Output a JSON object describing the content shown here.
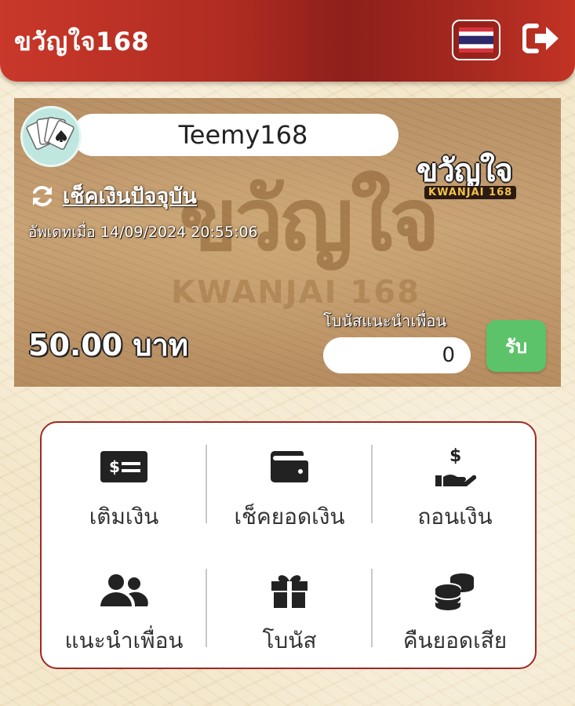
{
  "header": {
    "app_title": "ขวัญใจ168",
    "language_icon": "thai-flag-icon",
    "logout_icon": "logout-icon",
    "background_color": "#b02c22"
  },
  "account": {
    "username": "Teemy168",
    "avatar_icon": "playing-cards-icon",
    "logo_text": "ขวัญใจ",
    "logo_sub": "KWANJAI 168",
    "watermark_text": "ขวัญใจ",
    "watermark_sub": "KWANJAI 168",
    "refresh_label": "เช็คเงินปัจจุบัน",
    "updated_text": "อัพเดทเมื่อ 14/09/2024 20:55:06",
    "balance": "50.00 บาท",
    "bonus_label": "โบนัสแนะนำเพื่อน",
    "bonus_value": "0",
    "claim_label": "รับ",
    "claim_color": "#5cc36a"
  },
  "menu": {
    "border_color": "#9b2a26",
    "items": [
      {
        "label": "เติมเงิน",
        "icon": "money-bill-icon"
      },
      {
        "label": "เช็คยอดเงิน",
        "icon": "wallet-icon"
      },
      {
        "label": "ถอนเงิน",
        "icon": "hand-dollar-icon"
      },
      {
        "label": "แนะนำเพื่อน",
        "icon": "users-icon"
      },
      {
        "label": "โบนัส",
        "icon": "gift-icon"
      },
      {
        "label": "คืนยอดเสีย",
        "icon": "coins-icon"
      }
    ]
  }
}
